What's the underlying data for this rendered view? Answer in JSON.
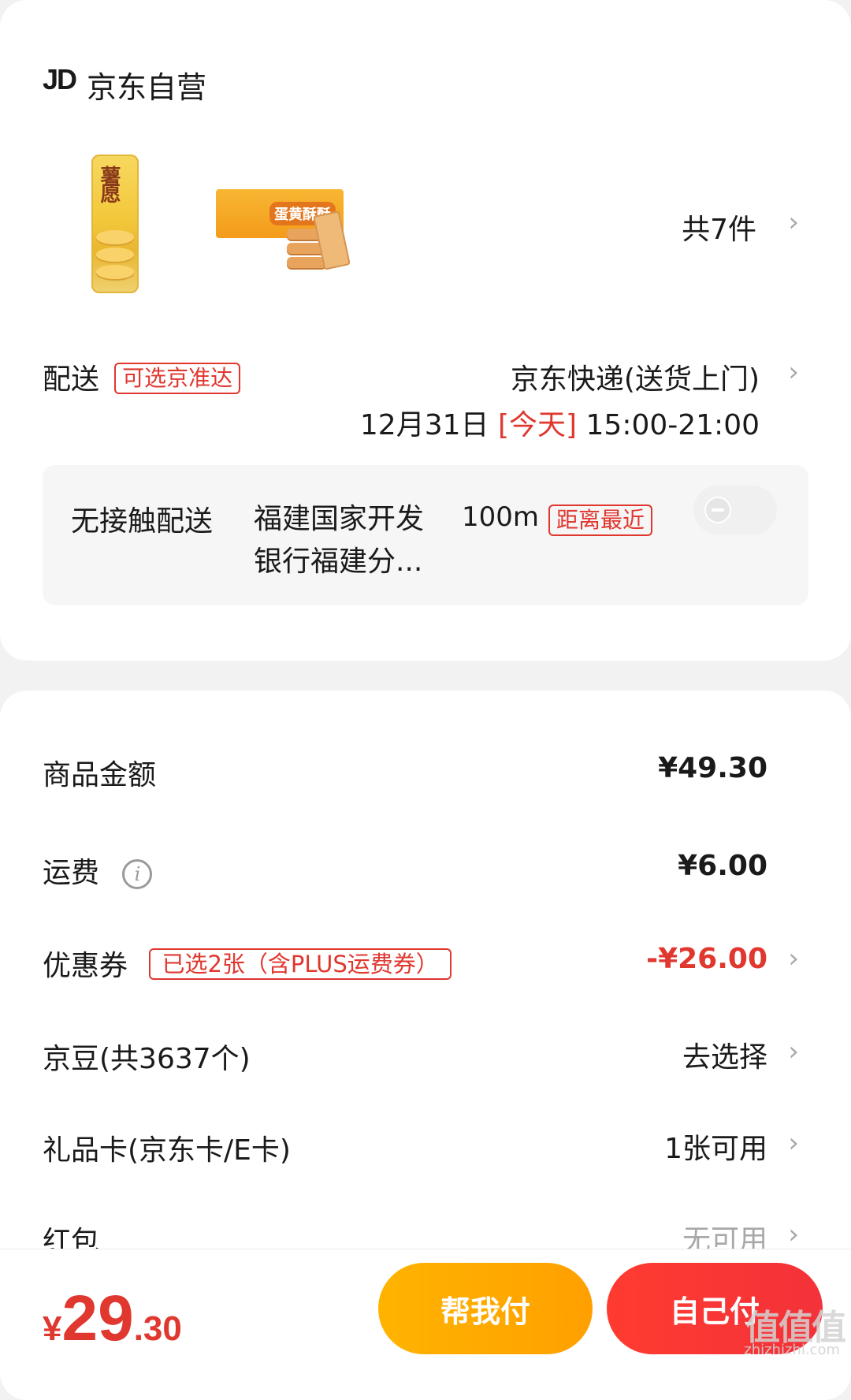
{
  "shop": {
    "logo": "JD",
    "name": "京东自营"
  },
  "products": {
    "item1_brand": "薯愿",
    "item2_label": "蛋黄酥酥",
    "count": "共7件"
  },
  "delivery": {
    "label": "配送",
    "tag": "可选京准达",
    "method": "京东快递(送货上门)",
    "date": "12月31日",
    "today": "[今天]",
    "time": "15:00-21:00",
    "contactless_label": "无接触配送",
    "station_line1": "福建国家开发",
    "station_line2": "银行福建分...",
    "distance": "100m",
    "distance_tag": "距离最近"
  },
  "summary": {
    "goods_label": "商品金额",
    "goods_value": "¥49.30",
    "shipping_label": "运费",
    "shipping_value": "¥6.00",
    "coupon_label": "优惠券",
    "coupon_tag": "已选2张（含PLUS运费券）",
    "coupon_value": "-¥26.00",
    "beans_label": "京豆(共3637个)",
    "beans_value": "去选择",
    "giftcard_label": "礼品卡(京东卡/E卡)",
    "giftcard_value": "1张可用",
    "redpacket_label": "红包",
    "redpacket_value": "无可用"
  },
  "footer": {
    "currency": "¥",
    "total_int": "29",
    "total_dec": ".30",
    "help_pay": "帮我付",
    "self_pay": "自己付",
    "watermark": "值值值",
    "watermark_url": "zhizhizhi.com"
  },
  "colors": {
    "accent_red": "#e0372f",
    "help_pay_orange": "#ffb300",
    "background": "#f2f2f2"
  }
}
